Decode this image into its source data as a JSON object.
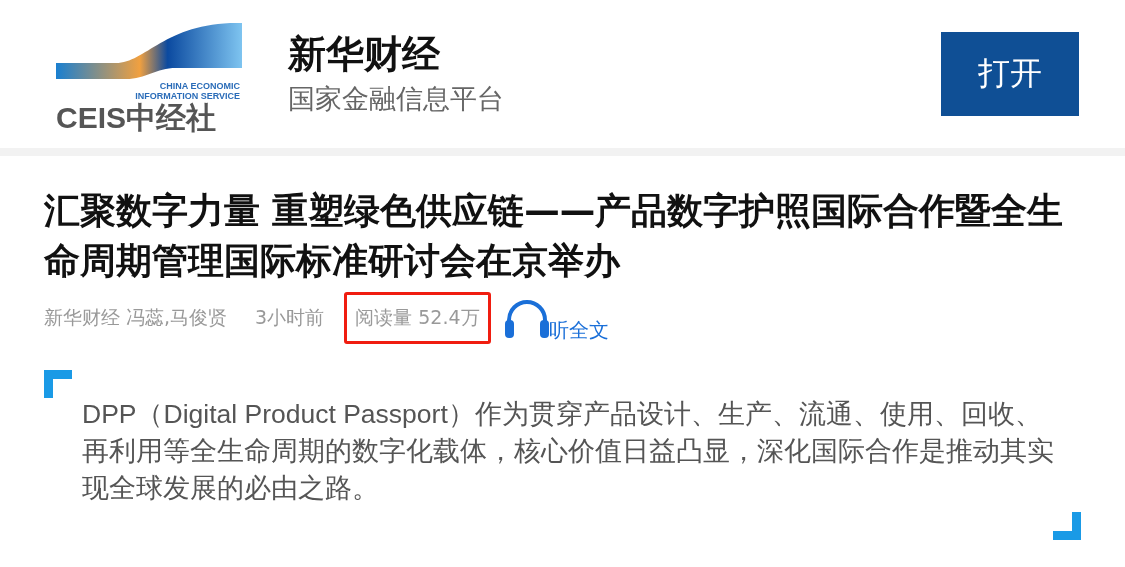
{
  "header": {
    "logo": {
      "line_1": "CHINA ECONOMIC",
      "line_2": "INFORMATION SERVICE",
      "wordmark": "CEIS中经社"
    },
    "app_name": "新华财经",
    "tagline": "国家金融信息平台",
    "open_button": "打开"
  },
  "article": {
    "title": "汇聚数字力量 重塑绿色供应链——产品数字护照国际合作暨全生命周期管理国际标准研讨会在京举办",
    "meta": {
      "source": "新华财经 冯蕊,马俊贤",
      "time": "3小时前",
      "read_count": {
        "text": "阅读量 52.4万",
        "highlighted": true
      },
      "listen": "听全文"
    },
    "summary": "DPP（Digital Product Passport）作为贯穿产品设计、生产、流通、使用、回收、再利用等全生命周期的数字化载体，核心价值日益凸显，深化国际合作是推动其实现全球发展的必由之路。"
  }
}
